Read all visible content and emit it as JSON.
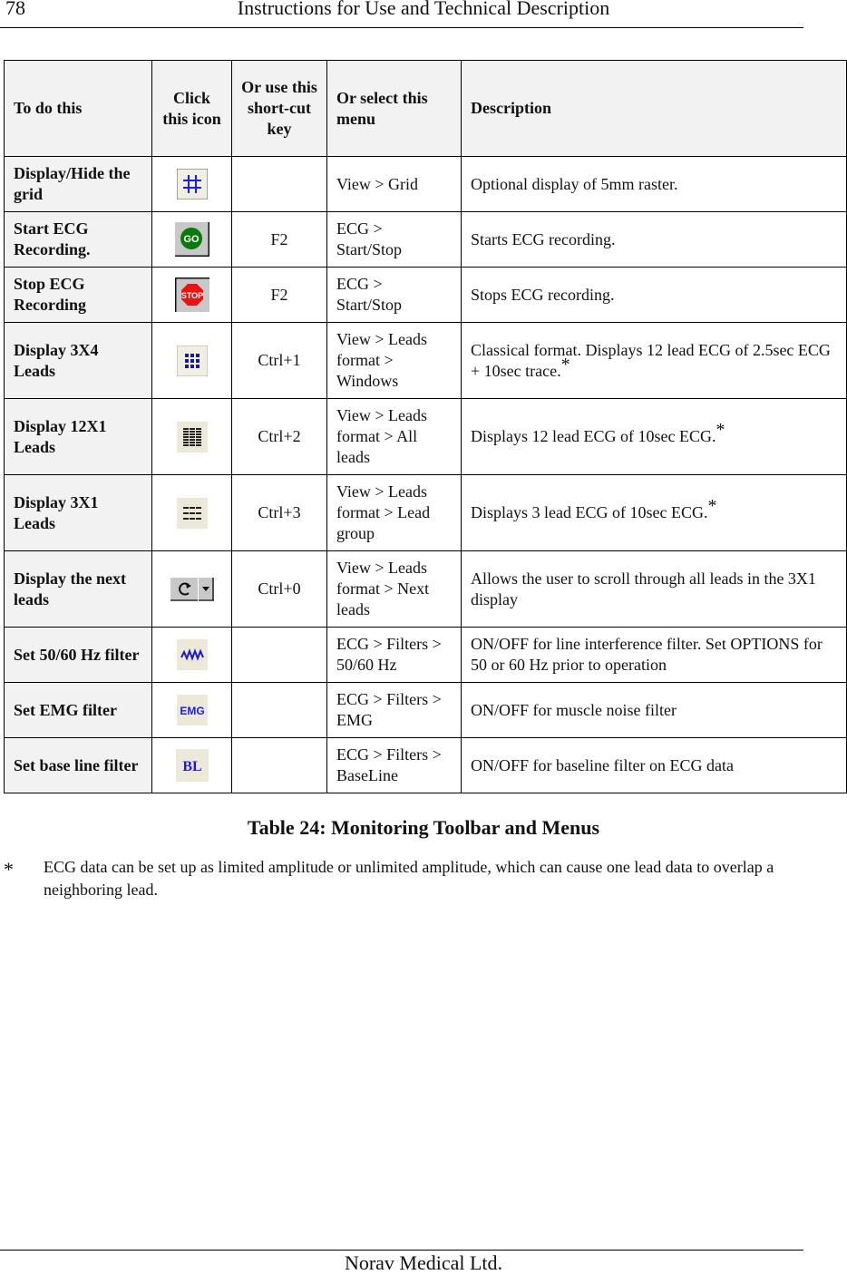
{
  "header": {
    "page_number": "78",
    "title": "Instructions for Use and Technical Description"
  },
  "table": {
    "columns": [
      "To do this",
      "Click this icon",
      "Or use this short-cut key",
      "Or select this menu",
      "Description"
    ],
    "rows": [
      {
        "action": "Display/Hide the grid",
        "icon": "grid-icon",
        "shortcut": "",
        "menu": "View > Grid",
        "description": "Optional display of 5mm raster.",
        "asterisk": ""
      },
      {
        "action": "Start ECG Recording.",
        "icon": "go-icon",
        "shortcut": "F2",
        "menu": "ECG > Start/Stop",
        "description": "Starts ECG recording.",
        "asterisk": ""
      },
      {
        "action": "Stop ECG Recording",
        "icon": "stop-icon",
        "shortcut": "F2",
        "menu": "ECG > Start/Stop",
        "description": "Stops ECG recording.",
        "asterisk": ""
      },
      {
        "action": "Display 3X4 Leads",
        "icon": "leads-3x4-icon",
        "shortcut": "Ctrl+1",
        "menu": "View > Leads format > Windows",
        "description": "Classical format. Displays 12 lead ECG of 2.5sec ECG + 10sec trace.",
        "asterisk": "*"
      },
      {
        "action": "Display 12X1 Leads",
        "icon": "leads-12x1-icon",
        "shortcut": "Ctrl+2",
        "menu": "View > Leads format > All leads",
        "description": "Displays 12 lead ECG of 10sec ECG.",
        "asterisk": "*"
      },
      {
        "action": "Display 3X1 Leads",
        "icon": "leads-3x1-icon",
        "shortcut": "Ctrl+3",
        "menu": "View > Leads format > Lead group",
        "description": "Displays 3 lead ECG of 10sec ECG.",
        "asterisk": "*"
      },
      {
        "action": "Display the next leads",
        "icon": "next-leads-icon",
        "shortcut": "Ctrl+0",
        "menu": "View > Leads format > Next leads",
        "description": "Allows the user to scroll through all leads in the 3X1 display",
        "asterisk": ""
      },
      {
        "action": "Set 50/60 Hz filter",
        "icon": "hz-filter-icon",
        "shortcut": "",
        "menu": "ECG > Filters > 50/60 Hz",
        "description": "ON/OFF for line interference filter. Set OPTIONS for 50 or 60 Hz prior to operation",
        "asterisk": ""
      },
      {
        "action": "Set EMG filter",
        "icon": "emg-filter-icon",
        "shortcut": "",
        "menu": "ECG > Filters > EMG",
        "description": "ON/OFF for muscle noise filter",
        "asterisk": ""
      },
      {
        "action": "Set base line filter",
        "icon": "baseline-filter-icon",
        "shortcut": "",
        "menu": "ECG > Filters > BaseLine",
        "description": "ON/OFF for baseline filter on ECG data",
        "asterisk": ""
      }
    ],
    "icon_labels": {
      "go": "GO",
      "stop": "STOP",
      "emg": "EMG",
      "bl": "BL"
    }
  },
  "caption": "Table 24: Monitoring Toolbar and Menus",
  "footnote": {
    "mark": "*",
    "text": "ECG data can be set up as limited amplitude or unlimited amplitude, which can cause one lead data to overlap a neighboring lead."
  },
  "footer": {
    "company": "Norav Medical Ltd."
  }
}
